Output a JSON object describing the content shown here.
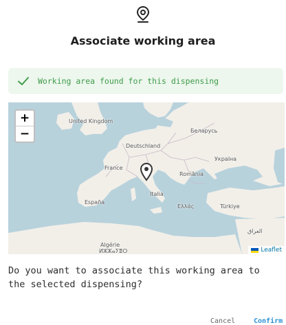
{
  "dialog": {
    "title": "Associate working area",
    "icon": "map-pin-icon"
  },
  "alert": {
    "message": "Working area found for this dispensing",
    "icon": "check-icon",
    "color": "#3f9b49"
  },
  "map": {
    "zoom_in": "+",
    "zoom_out": "−",
    "marker_icon": "map-marker-icon",
    "attribution": "Leaflet",
    "labels": {
      "united_kingdom": "United Kingdom",
      "belarus": "Беларусь",
      "deutschland": "Deutschland",
      "ukraine": "Україна",
      "france": "France",
      "romania": "România",
      "italia": "Italia",
      "espana": "España",
      "ellada": "Ελλάς",
      "turkiye": "Türkiye",
      "iraq": "العراق",
      "algerie": "Algérie",
      "algerie_berber": "ⵍⵣⵣⴰⵢⴻⵔ"
    }
  },
  "question": "Do you want to associate this working area to the selected dispensing?",
  "actions": {
    "cancel": "Cancel",
    "confirm": "Confirm",
    "confirm_color": "#2b8fd6"
  }
}
